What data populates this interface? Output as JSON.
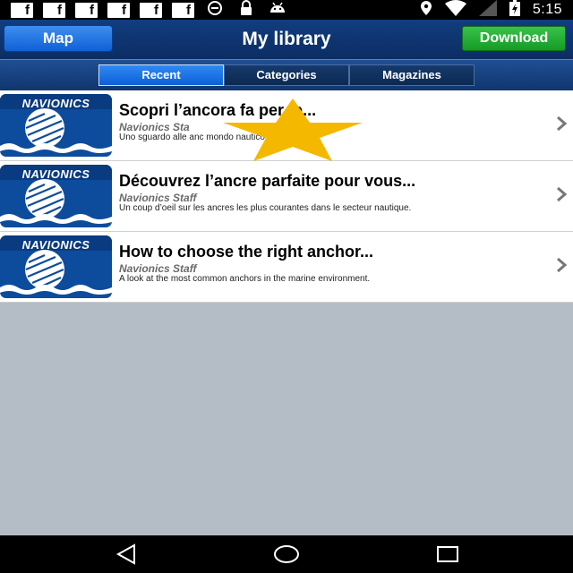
{
  "status_bar": {
    "notification_icons": [
      "facebook-icon",
      "facebook-icon",
      "facebook-icon",
      "facebook-icon",
      "facebook-icon",
      "facebook-icon"
    ],
    "extra_icons": [
      "sync-icon",
      "lock-icon",
      "android-icon"
    ],
    "time": "5:15",
    "system_icons": [
      "location-icon",
      "wifi-icon",
      "signal-icon",
      "battery-charging-icon"
    ]
  },
  "navbar": {
    "map_label": "Map",
    "title": "My library",
    "download_label": "Download"
  },
  "tabs": [
    {
      "label": "Recent",
      "active": true
    },
    {
      "label": "Categories",
      "active": false
    },
    {
      "label": "Magazines",
      "active": false
    }
  ],
  "items": [
    {
      "thumb_label": "NAVIONICS",
      "title": "Scopri l’ancora      fa per te...",
      "author": "Navionics Sta",
      "description": "Uno sguardo alle anc                                     mondo nautico."
    },
    {
      "thumb_label": "NAVIONICS",
      "title": "Découvrez l’ancre parfaite pour vous...",
      "author": "Navionics Staff",
      "description": "Un coup d’oeil sur les ancres les plus courantes dans le secteur nautique."
    },
    {
      "thumb_label": "NAVIONICS",
      "title": "How to choose the right anchor...",
      "author": "Navionics Staff",
      "description": "A look at the most common anchors in the marine environment."
    }
  ],
  "colors": {
    "navbar": "#0b2d64",
    "map_button": "#1160d6",
    "download_button": "#159b26",
    "star": "#f5b800",
    "background": "#b4bdc6"
  }
}
